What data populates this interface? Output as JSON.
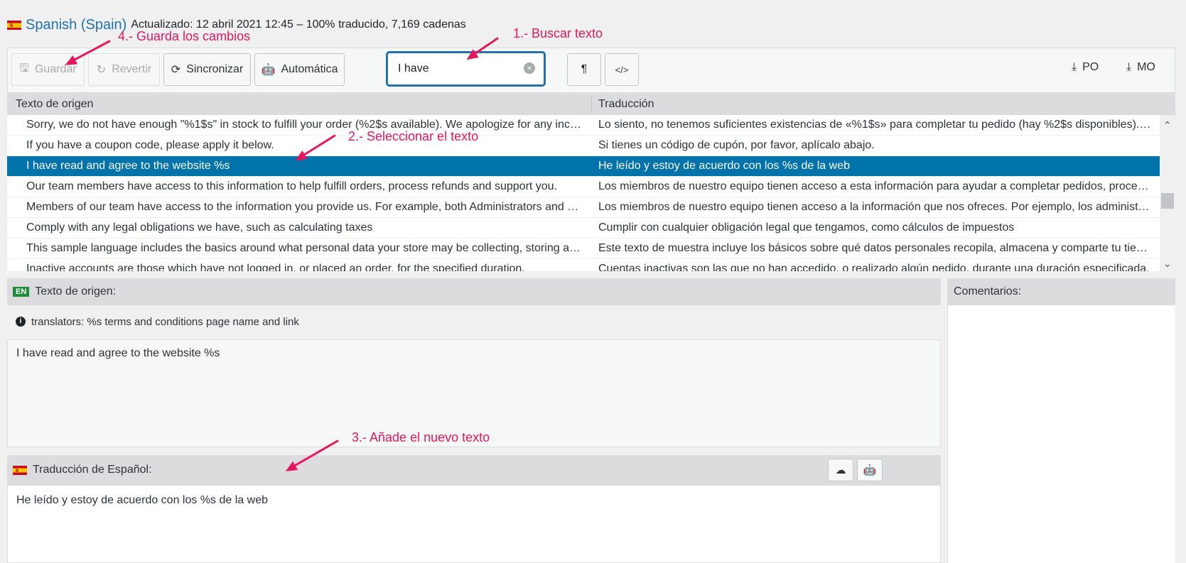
{
  "header": {
    "language": "Spanish (Spain)",
    "meta": "Actualizado: 12 abril 2021 12:45 – 100% traducido, 7,169 cadenas"
  },
  "toolbar": {
    "save_label": "Guardar",
    "revert_label": "Revertir",
    "sync_label": "Sincronizar",
    "auto_label": "Automática",
    "search_value": "I have",
    "download_po": "PO",
    "download_mo": "MO"
  },
  "grid": {
    "col_source": "Texto de origen",
    "col_translation": "Traducción",
    "rows": [
      {
        "src": "Sorry, we do not have enough \"%1$s\" in stock to fulfill your order (%2$s available). We apologize for any inconvenience caused.",
        "trn": "Lo siento, no tenemos suficientes existencias de «%1$s» para completar tu pedido (hay %2$s disponibles). Disculpa las molestias."
      },
      {
        "src": "If you have a coupon code, please apply it below.",
        "trn": "Si tienes un código de cupón, por favor, aplícalo abajo."
      },
      {
        "src": "I have read and agree to the website %s",
        "trn": "He leído y estoy de acuerdo con los %s de la web"
      },
      {
        "src": "Our team members have access to this information to help fulfill orders, process refunds and support you.",
        "trn": "Los miembros de nuestro equipo tienen acceso a esta información para ayudar a completar pedidos, procesar reembolsos y darte soporte."
      },
      {
        "src": "Members of our team have access to the information you provide us. For example, both Administrators and Shop Managers can access:",
        "trn": "Los miembros de nuestro equipo tienen acceso a la información que nos ofreces. Por ejemplo, los administradores y gestores de la tienda pueden acceder a:"
      },
      {
        "src": "Comply with any legal obligations we have, such as calculating taxes",
        "trn": "Cumplir con cualquier obligación legal que tengamos, como cálculos de impuestos"
      },
      {
        "src": "This sample language includes the basics around what personal data your store may be collecting, storing and sharing.",
        "trn": "Este texto de muestra incluye los básicos sobre qué datos personales recopila, almacena y comparte tu tienda."
      },
      {
        "src": "Inactive accounts are those which have not logged in, or placed an order, for the specified duration.",
        "trn": "Cuentas inactivas son las que no han accedido, o realizado algún pedido, durante una duración especificada."
      }
    ]
  },
  "source_pane": {
    "lang_badge": "EN",
    "title": "Texto de origen:",
    "note": "translators: %s terms and conditions page name and link",
    "text": "I have read and agree to the website %s"
  },
  "comments": {
    "title": "Comentarios:"
  },
  "translation_pane": {
    "title": "Traducción de Español:",
    "text": "He leído y estoy de acuerdo con los %s de la web"
  },
  "annotations": {
    "step1": "1.- Buscar texto",
    "step2": "2.- Seleccionar el texto",
    "step3": "3.- Añade el nuevo texto",
    "step4": "4.- Guarda los cambios"
  },
  "colors": {
    "accent": "#2271b1",
    "selected": "#0073aa",
    "annotation": "#e8175d"
  }
}
